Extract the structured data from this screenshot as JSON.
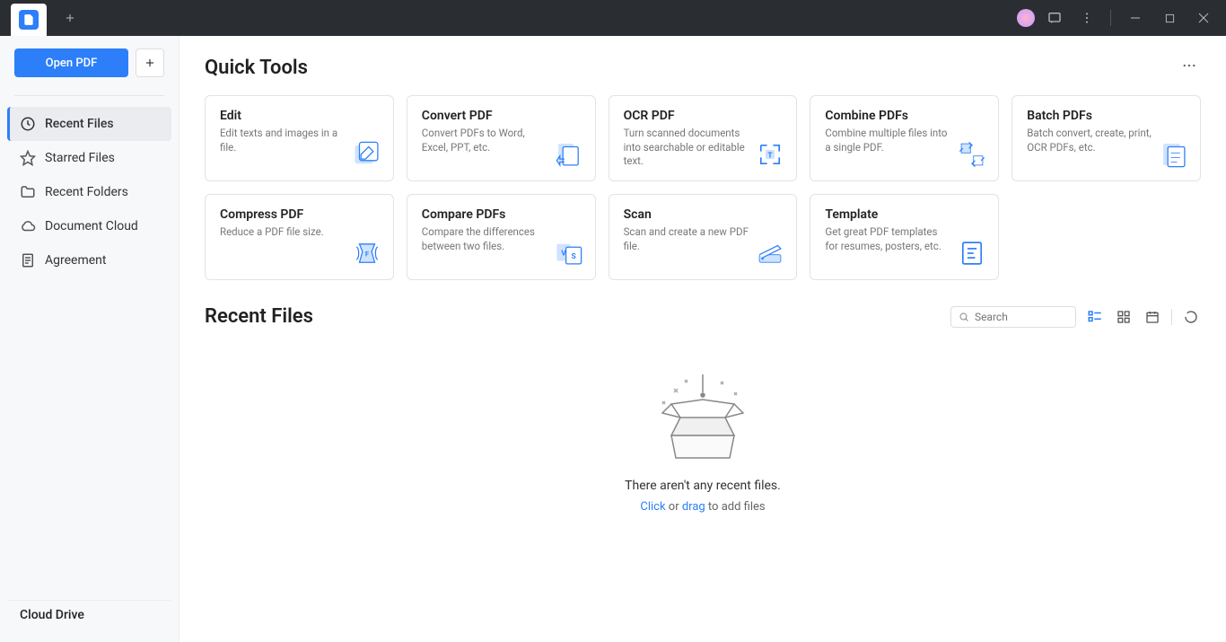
{
  "header": {
    "app_icon": "pdf-logo"
  },
  "sidebar": {
    "open_pdf_label": "Open PDF",
    "items": [
      {
        "label": "Recent Files",
        "icon": "clock-icon",
        "active": true
      },
      {
        "label": "Starred Files",
        "icon": "star-icon",
        "active": false
      },
      {
        "label": "Recent Folders",
        "icon": "folder-icon",
        "active": false
      },
      {
        "label": "Document Cloud",
        "icon": "cloud-icon",
        "active": false
      },
      {
        "label": "Agreement",
        "icon": "document-icon",
        "active": false
      }
    ],
    "cloud_drive_label": "Cloud Drive"
  },
  "quick_tools": {
    "title": "Quick Tools",
    "cards": [
      {
        "title": "Edit",
        "desc": "Edit texts and images in a file."
      },
      {
        "title": "Convert PDF",
        "desc": "Convert PDFs to Word, Excel, PPT, etc."
      },
      {
        "title": "OCR PDF",
        "desc": "Turn scanned documents into searchable or editable text."
      },
      {
        "title": "Combine PDFs",
        "desc": "Combine multiple files into a single PDF."
      },
      {
        "title": "Batch PDFs",
        "desc": "Batch convert, create, print, OCR PDFs, etc."
      },
      {
        "title": "Compress PDF",
        "desc": "Reduce a PDF file size."
      },
      {
        "title": "Compare PDFs",
        "desc": "Compare the differences between two files."
      },
      {
        "title": "Scan",
        "desc": "Scan and create a new PDF file."
      },
      {
        "title": "Template",
        "desc": "Get great PDF templates for resumes, posters, etc."
      }
    ]
  },
  "recent_files": {
    "title": "Recent Files",
    "search_placeholder": "Search",
    "empty_message": "There aren't any recent files.",
    "empty_click": "Click",
    "empty_or": " or ",
    "empty_drag": "drag",
    "empty_suffix": " to add files"
  }
}
